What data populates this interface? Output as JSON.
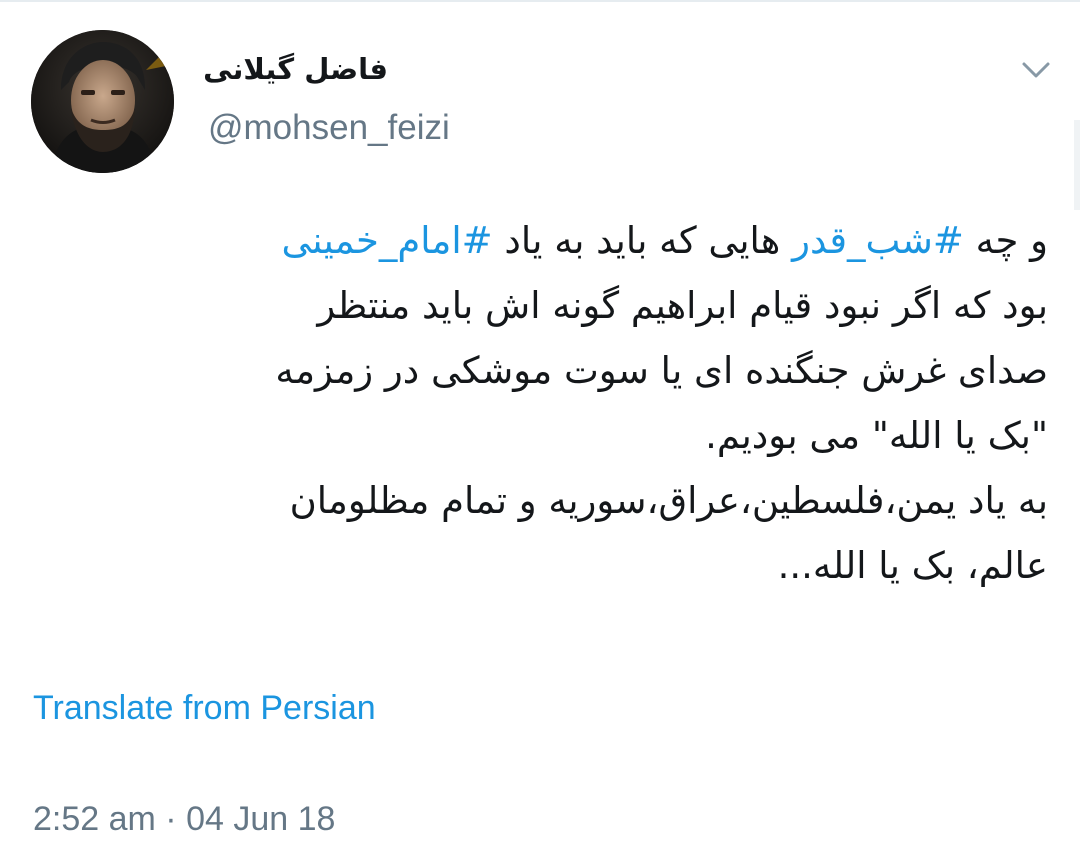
{
  "header": {
    "display_name": "فاضل گیلانی",
    "handle": "@mohsen_feizi",
    "avatar_icon": "profile-photo",
    "menu_icon": "chevron-down-icon"
  },
  "tweet": {
    "line1_pre": "و چه ",
    "hashtag1": "#شب_قدر",
    "line1_mid": " هایی که باید به یاد ",
    "hashtag2": "#امام_خمینی",
    "line2": "بود که اگر نبود قیام ابراهیم گونه اش باید منتظر",
    "line3": "صدای غرش جنگنده ای یا سوت موشکی در زمزمه",
    "line4": "\"بک یا الله\" می بودیم.",
    "line5": "به یاد یمن،فلسطین،عراق،سوریه و تمام مظلومان",
    "line6": "عالم، بک یا الله..."
  },
  "translate_label": "Translate from Persian",
  "timestamp": "2:52 am · 04 Jun 18",
  "colors": {
    "link": "#1b95e0",
    "text": "#14171a",
    "muted": "#657786"
  }
}
